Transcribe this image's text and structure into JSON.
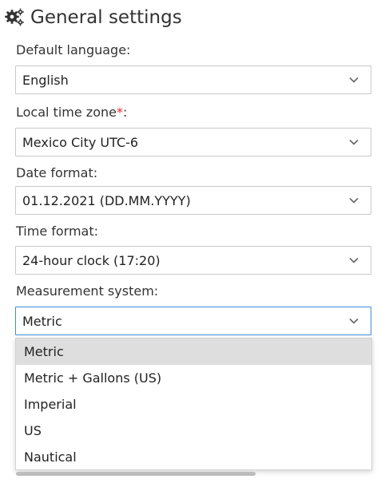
{
  "header": {
    "title": "General settings",
    "icon": "gears-icon"
  },
  "fields": {
    "language": {
      "label": "Default language:",
      "value": "English"
    },
    "timezone": {
      "label": "Local time zone",
      "required_mark": "*",
      "label_suffix": ":",
      "value": "Mexico City UTC-6"
    },
    "date_format": {
      "label": "Date format:",
      "value": "01.12.2021 (DD.MM.YYYY)"
    },
    "time_format": {
      "label": "Time format:",
      "value": "24-hour clock (17:20)"
    },
    "measurement": {
      "label": "Measurement system:",
      "value": "Metric",
      "options": [
        "Metric",
        "Metric + Gallons (US)",
        "Imperial",
        "US",
        "Nautical"
      ],
      "selected_option": "Metric"
    }
  },
  "colors": {
    "required": "#e0282e",
    "focus_border": "#3e8ed6",
    "option_highlight": "#dedede"
  }
}
